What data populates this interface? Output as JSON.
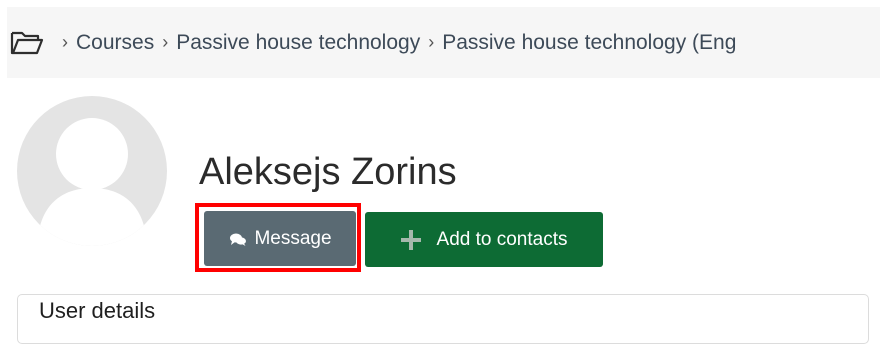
{
  "breadcrumb": {
    "home_icon": "folder-icon",
    "separator": "›",
    "items": [
      {
        "label": "Courses"
      },
      {
        "label": "Passive house technology"
      },
      {
        "label": "Passive house technology (Eng"
      }
    ]
  },
  "profile": {
    "avatar_icon": "default-user-avatar",
    "name": "Aleksejs Zorins"
  },
  "actions": {
    "message": {
      "label": "Message",
      "icon": "chat-bubbles-icon",
      "color": "#5a6a73"
    },
    "add_contact": {
      "label": "Add to contacts",
      "icon": "plus-icon",
      "color": "#0d6b34"
    }
  },
  "highlight": {
    "color": "#ff0000"
  },
  "sections": {
    "user_details_title": "User details"
  }
}
